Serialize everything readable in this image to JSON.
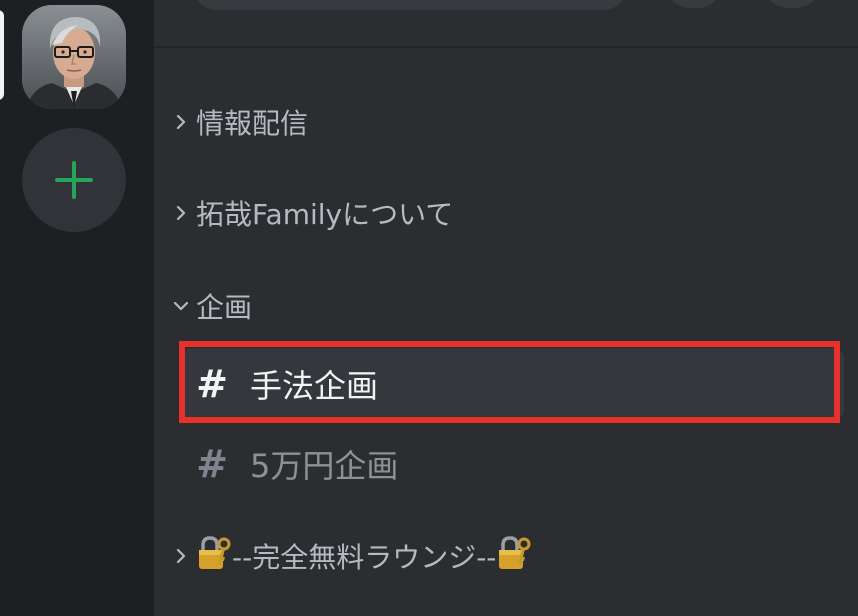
{
  "colors": {
    "rail_bg": "#1e1f22",
    "panel_bg": "#2b2d31",
    "selected_bg": "#35373c",
    "add_icon": "#23a55a",
    "highlight": "#e8312b"
  },
  "rail": {
    "server_avatar_icon": "server-avatar-photo",
    "add_icon": "plus-icon"
  },
  "categories": [
    {
      "label": "情報配信",
      "expanded": false
    },
    {
      "label": "拓哉Familyについて",
      "expanded": false
    },
    {
      "label": "企画",
      "expanded": true
    },
    {
      "label_prefix_icon": "lock-key-emoji",
      "label": "--完全無料ラウンジ--",
      "label_suffix_icon": "lock-key-emoji",
      "expanded": false
    }
  ],
  "channels": [
    {
      "hash": "#",
      "name": "手法企画",
      "selected": true
    },
    {
      "hash": "#",
      "name": "5万円企画",
      "selected": false
    }
  ]
}
